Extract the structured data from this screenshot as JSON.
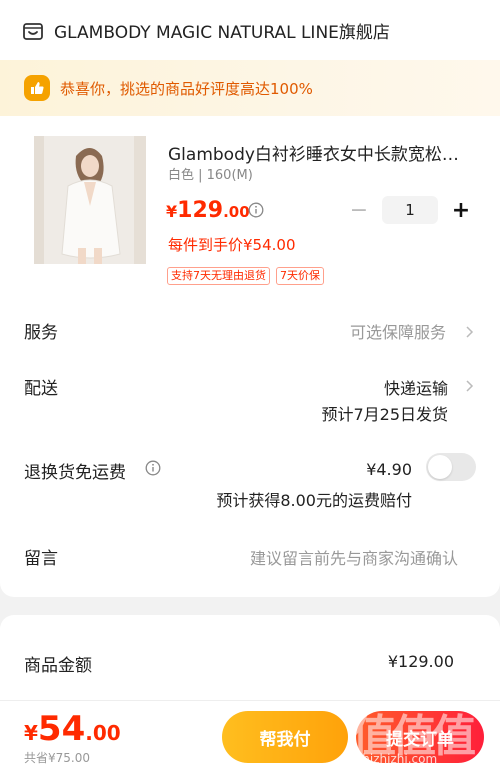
{
  "shop": {
    "icon": "shop-icon",
    "name": "GLAMBODY MAGIC NATURAL LINE旗舰店"
  },
  "banner": {
    "icon": "thumbs-up-icon",
    "text": "恭喜你，挑选的商品好评度高达100%"
  },
  "product": {
    "image_icon": "product-photo",
    "title": "Glambody白衬衫睡衣女中长款宽松…",
    "spec": "白色 | 160(M)",
    "price_symbol": "¥",
    "price_int": "129",
    "price_dec": ".00",
    "final_price": "每件到手价¥54.00",
    "tags": [
      "支持7天无理由退货",
      "7天价保"
    ],
    "quantity": "1",
    "minus": "−",
    "plus": "+"
  },
  "rows": {
    "service": {
      "label": "服务",
      "value": "可选保障服务"
    },
    "delivery": {
      "label": "配送",
      "value": "快递运输",
      "sub": "预计7月25日发货"
    },
    "return_ship": {
      "label": "退换货免运费",
      "price": "¥4.90",
      "sub": "预计获得8.00元的运费赔付",
      "toggle_on": false
    },
    "note": {
      "label": "留言",
      "placeholder": "建议留言前先与商家沟通确认"
    }
  },
  "summary": {
    "label": "商品金额",
    "value": "¥129.00"
  },
  "bottom": {
    "total_symbol": "¥",
    "total_int": "54",
    "total_dec": ".00",
    "saved": "共省¥75.00",
    "help_pay": "帮我付",
    "pay": "提交订单"
  },
  "watermark": {
    "glyphs": "值值值",
    "url": "zhizhizhi.com"
  },
  "colors": {
    "accent_red": "#ff2a00",
    "banner_orange": "#e05a00",
    "help_btn": "#ffa20a",
    "pay_btn": "#ff1f3a"
  }
}
